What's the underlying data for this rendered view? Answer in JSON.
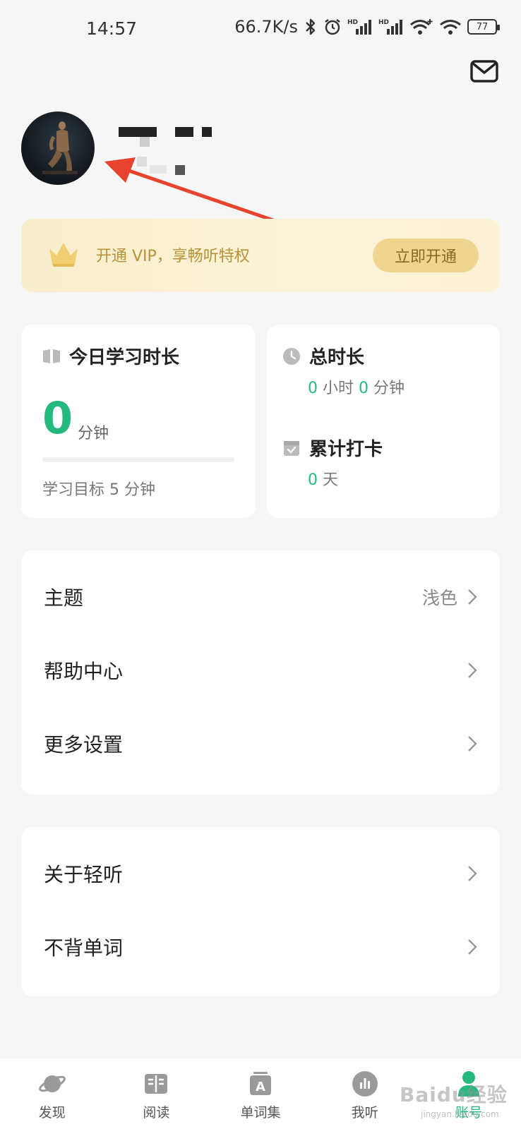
{
  "status_bar": {
    "time": "14:57",
    "network_speed": "66.7K/s",
    "battery_level": "77",
    "icons": [
      "bluetooth-icon",
      "alarm-icon",
      "hd-signal-icon",
      "hd-signal-icon",
      "wifi-plus-icon",
      "wifi-icon",
      "battery-icon"
    ]
  },
  "header": {
    "mail_icon": "mail-icon"
  },
  "profile": {
    "avatar": "avatar"
  },
  "vip_banner": {
    "icon": "crown-icon",
    "text": "开通 VIP，享畅听特权",
    "button_label": "立即开通",
    "colors": {
      "text": "#b8923a",
      "button_bg": "#efd58f",
      "button_text": "#8a6a1f"
    }
  },
  "today_card": {
    "icon": "book-icon",
    "title": "今日学习时长",
    "value": "0",
    "unit": "分钟",
    "progress": 0,
    "goal_text": "学习目标 5 分钟"
  },
  "total_card": {
    "total_icon": "clock-icon",
    "total_title": "总时长",
    "hours_value": "0",
    "hours_unit": "小时",
    "minutes_value": "0",
    "minutes_unit": "分钟",
    "checkin_icon": "calendar-check-icon",
    "checkin_title": "累计打卡",
    "checkin_value": "0",
    "checkin_unit": "天"
  },
  "settings_list": [
    {
      "label": "主题",
      "value": "浅色"
    },
    {
      "label": "帮助中心",
      "value": ""
    },
    {
      "label": "更多设置",
      "value": ""
    }
  ],
  "about_list": [
    {
      "label": "关于轻听"
    },
    {
      "label": "不背单词"
    }
  ],
  "tab_bar": {
    "tabs": [
      {
        "label": "发现",
        "icon": "planet-icon"
      },
      {
        "label": "阅读",
        "icon": "reading-icon"
      },
      {
        "label": "单词集",
        "icon": "word-set-icon"
      },
      {
        "label": "我听",
        "icon": "audio-icon"
      },
      {
        "label": "账号",
        "icon": "account-icon",
        "active": true
      }
    ]
  },
  "watermark": {
    "text": "Baidu经验",
    "sub": "jingyan.baidu.com"
  },
  "accent_color": "#26b97f"
}
